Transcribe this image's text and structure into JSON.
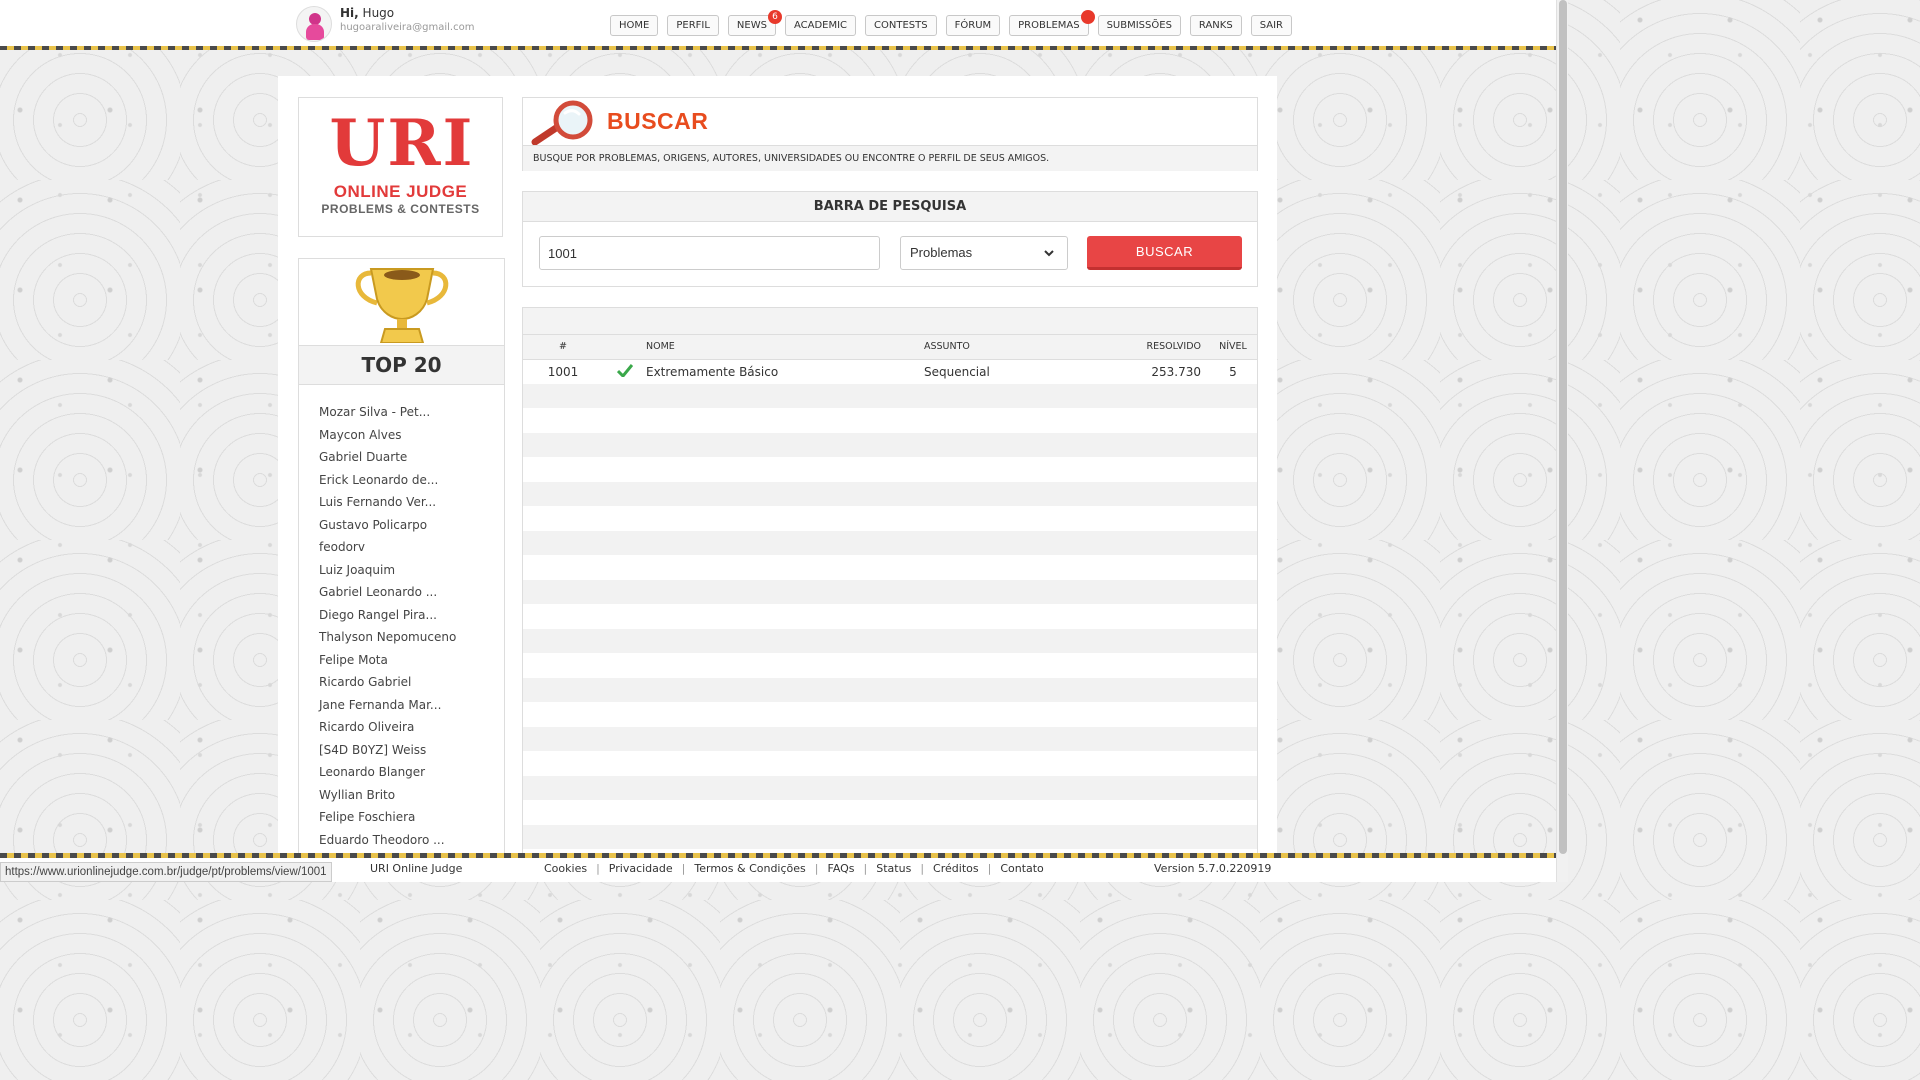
{
  "header": {
    "greeting_prefix": "Hi,",
    "user_name": "Hugo",
    "email": "hugoaraliveira@gmail.com",
    "nav": [
      {
        "label": "HOME"
      },
      {
        "label": "PERFIL"
      },
      {
        "label": "NEWS",
        "badge": "6"
      },
      {
        "label": "ACADEMIC"
      },
      {
        "label": "CONTESTS"
      },
      {
        "label": "FÓRUM"
      },
      {
        "label": "PROBLEMAS",
        "badge": ""
      },
      {
        "label": "SUBMISSÕES"
      },
      {
        "label": "RANKS"
      },
      {
        "label": "SAIR"
      }
    ]
  },
  "logo": {
    "title": "URI",
    "line1": "ONLINE JUDGE",
    "line2": "PROBLEMS & CONTESTS"
  },
  "top20": {
    "title": "TOP 20",
    "users": [
      "Mozar Silva - Pet...",
      "Maycon Alves",
      "Gabriel Duarte",
      "Erick Leonardo de...",
      "Luis Fernando Ver...",
      "Gustavo Policarpo",
      "feodorv",
      "Luiz Joaquim",
      "Gabriel Leonardo ...",
      "Diego Rangel Pira...",
      "Thalyson Nepomuceno",
      "Felipe Mota",
      "Ricardo Gabriel",
      "Jane Fernanda Mar...",
      "Ricardo Oliveira",
      "[S4D B0YZ] Weiss",
      "Leonardo Blanger",
      "Wyllian Brito",
      "Felipe Foschiera",
      "Eduardo Theodoro ..."
    ]
  },
  "busca": {
    "title": "BUSCAR",
    "description": "BUSQUE POR PROBLEMAS, ORIGENS, AUTORES, UNIVERSIDADES OU ENCONTRE O PERFIL DE SEUS AMIGOS."
  },
  "searchbar": {
    "title": "BARRA DE PESQUISA",
    "query": "1001",
    "category": "Problemas",
    "button": "BUSCAR"
  },
  "results": {
    "columns": {
      "id": "#",
      "name": "NOME",
      "subject": "ASSUNTO",
      "solved": "RESOLVIDO",
      "level": "NÍVEL"
    },
    "rows": [
      {
        "id": "1001",
        "solved_by_user": true,
        "name": "Extremamente Básico",
        "subject": "Sequencial",
        "solved": "253.730",
        "level": "5"
      }
    ]
  },
  "footer": {
    "status_url": "https://www.urionlinejudge.com.br/judge/pt/problems/view/1001",
    "copyright": "URI Online Judge",
    "links": [
      "Cookies",
      "Privacidade",
      "Termos & Condições",
      "FAQs",
      "Status",
      "Créditos",
      "Contato"
    ],
    "version": "Version 5.7.0.220919"
  },
  "colors": {
    "accent": "#e84545",
    "title_orange": "#e84c1e",
    "check_green": "#3aa84a"
  }
}
